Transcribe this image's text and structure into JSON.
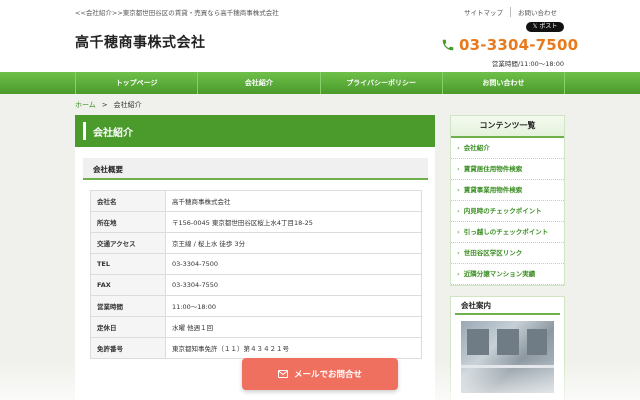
{
  "header": {
    "tagline": "<<会社紹介>>東京都世田谷区の賃貸・売買なら高千穂商事株式会社",
    "site_title": "高千穂商事株式会社",
    "top_links": [
      "サイトマップ",
      "お問い合わせ"
    ],
    "x_post": "𝕏 ポスト",
    "phone": "03-3304-7500",
    "hours": "営業時間/11:00～18:00"
  },
  "nav": [
    "トップページ",
    "会社紹介",
    "プライバシーポリシー",
    "お問い合わせ"
  ],
  "breadcrumb": {
    "home": "ホーム",
    "separator": ">",
    "current": "会社紹介"
  },
  "main": {
    "page_title": "会社紹介",
    "section_title": "会社概要",
    "rows": [
      {
        "k": "会社名",
        "v": "高千穂商事株式会社"
      },
      {
        "k": "所在地",
        "v": "〒156-0045 東京都世田谷区桜上水4丁目18-25"
      },
      {
        "k": "交通アクセス",
        "v": "京王線 / 桜上水 徒歩 3分"
      },
      {
        "k": "TEL",
        "v": "03-3304-7500"
      },
      {
        "k": "FAX",
        "v": "03-3304-7550"
      },
      {
        "k": "営業時間",
        "v": "11:00～18:00"
      },
      {
        "k": "定休日",
        "v": "水曜 他週１回"
      },
      {
        "k": "免許番号",
        "v": "東京都知事免許（１１）第４３４２１号"
      }
    ]
  },
  "sidebar": {
    "title": "コンテンツ一覧",
    "items": [
      "会社紹介",
      "賃貸居住用物件検索",
      "賃貸事業用物件検索",
      "内見時のチェックポイント",
      "引っ越しのチェックポイント",
      "世田谷区学区リンク",
      "近隣分譲マンション実績"
    ],
    "guide_title": "会社案内"
  },
  "mail_button": "メールでお問合せ",
  "colors": {
    "green": "#4a9a2c",
    "orange": "#e87a1e",
    "button": "#f07060"
  }
}
